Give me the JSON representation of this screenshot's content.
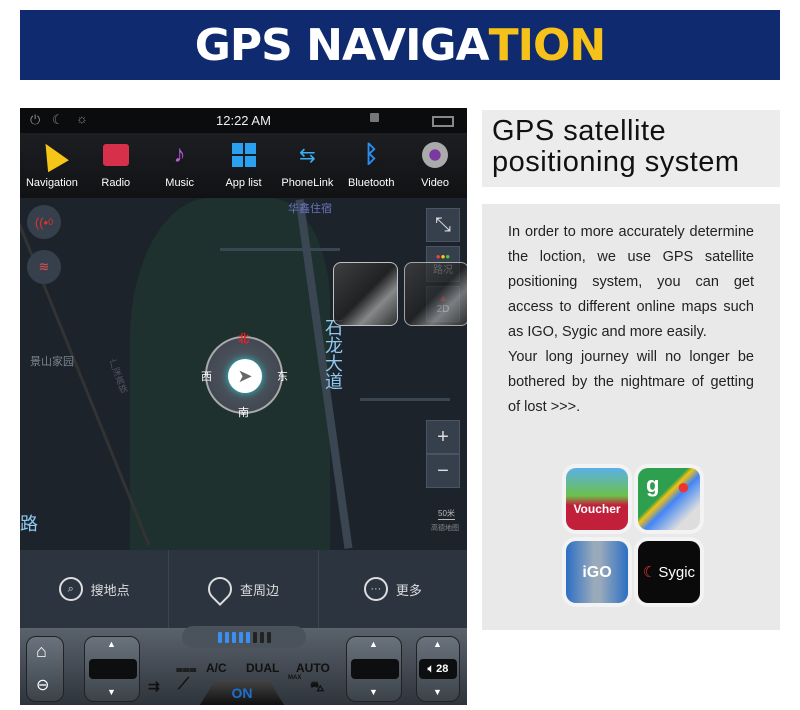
{
  "banner": {
    "title_white": "GPS NAVIGA",
    "title_yellow": "TION",
    "accent": "#f6c21a",
    "background": "#0f2a6e"
  },
  "status_bar": {
    "time": "12:22 AM",
    "icons": [
      "power-icon",
      "night-mode-icon",
      "brightness-icon",
      "lock-icon",
      "recent-apps-icon"
    ]
  },
  "apps": [
    {
      "label": "Navigation",
      "icon": "navigation-icon"
    },
    {
      "label": "Radio",
      "icon": "radio-icon"
    },
    {
      "label": "Music",
      "icon": "music-icon"
    },
    {
      "label": "App list",
      "icon": "app-list-icon"
    },
    {
      "label": "PhoneLink",
      "icon": "phonelink-icon"
    },
    {
      "label": "Bluetooth",
      "icon": "bluetooth-icon"
    },
    {
      "label": "Video",
      "icon": "video-icon"
    }
  ],
  "map": {
    "labels": {
      "top": "华鑫住宿",
      "left_place": "景山家园",
      "road": "石龙大道",
      "road_left": "路",
      "railway": "广深高铁"
    },
    "alert_count": "0",
    "compass": {
      "north": "北",
      "south": "南",
      "east": "东",
      "west": "西"
    },
    "traffic_label": "路况",
    "view_mode": "2D",
    "zoom_in": "+",
    "zoom_out": "−",
    "scale": "50米",
    "provider": "高德地图"
  },
  "bottom_bar": [
    {
      "label": "搜地点",
      "icon": "search-icon"
    },
    {
      "label": "查周边",
      "icon": "location-pin-icon"
    },
    {
      "label": "更多",
      "icon": "more-icon"
    }
  ],
  "climate": {
    "ac": "A/C",
    "dual": "DUAL",
    "auto": "AUTO",
    "on": "ON",
    "max": "MAX",
    "volume": "28",
    "fan_level": 5,
    "fan_max": 8
  },
  "title_box": {
    "line1": "GPS satellite",
    "line2": "positioning system"
  },
  "description": {
    "p1": "In order to more accurately determine the loction, we use GPS satellite positioning system, you can get access to different online maps such as IGO, Sygic and more easily.",
    "p2": "Your long journey will no longer be bothered by the nightmare of getting of lost  >>>."
  },
  "map_apps": [
    {
      "name": "Voucher"
    },
    {
      "name": "Google Maps"
    },
    {
      "name": "iGO"
    },
    {
      "name": "Sygic"
    }
  ]
}
